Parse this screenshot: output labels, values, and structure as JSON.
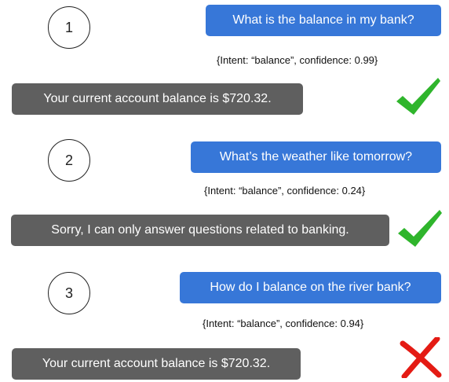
{
  "colors": {
    "user_bubble_bg": "#3777d8",
    "user_bubble_text": "#ffffff",
    "bot_bubble_bg": "#5f5f5f",
    "bot_bubble_text": "#ffffff",
    "check_color": "#2fb52c",
    "cross_color": "#e41b14"
  },
  "exchanges": [
    {
      "step": "1",
      "user_message": "What is the balance in my bank?",
      "intent": "{Intent: “balance”, confidence: 0.99}",
      "bot_reply": "Your current account balance is $720.32.",
      "result_icon": "check-icon"
    },
    {
      "step": "2",
      "user_message": "What’s the weather like tomorrow?",
      "intent": "{Intent: “balance”, confidence: 0.24}",
      "bot_reply": "Sorry, I can only answer questions related to banking.",
      "result_icon": "check-icon"
    },
    {
      "step": "3",
      "user_message": "How do I balance on the river bank?",
      "intent": "{Intent: “balance”, confidence: 0.94}",
      "bot_reply": "Your current account balance is $720.32.",
      "result_icon": "cross-icon"
    }
  ]
}
